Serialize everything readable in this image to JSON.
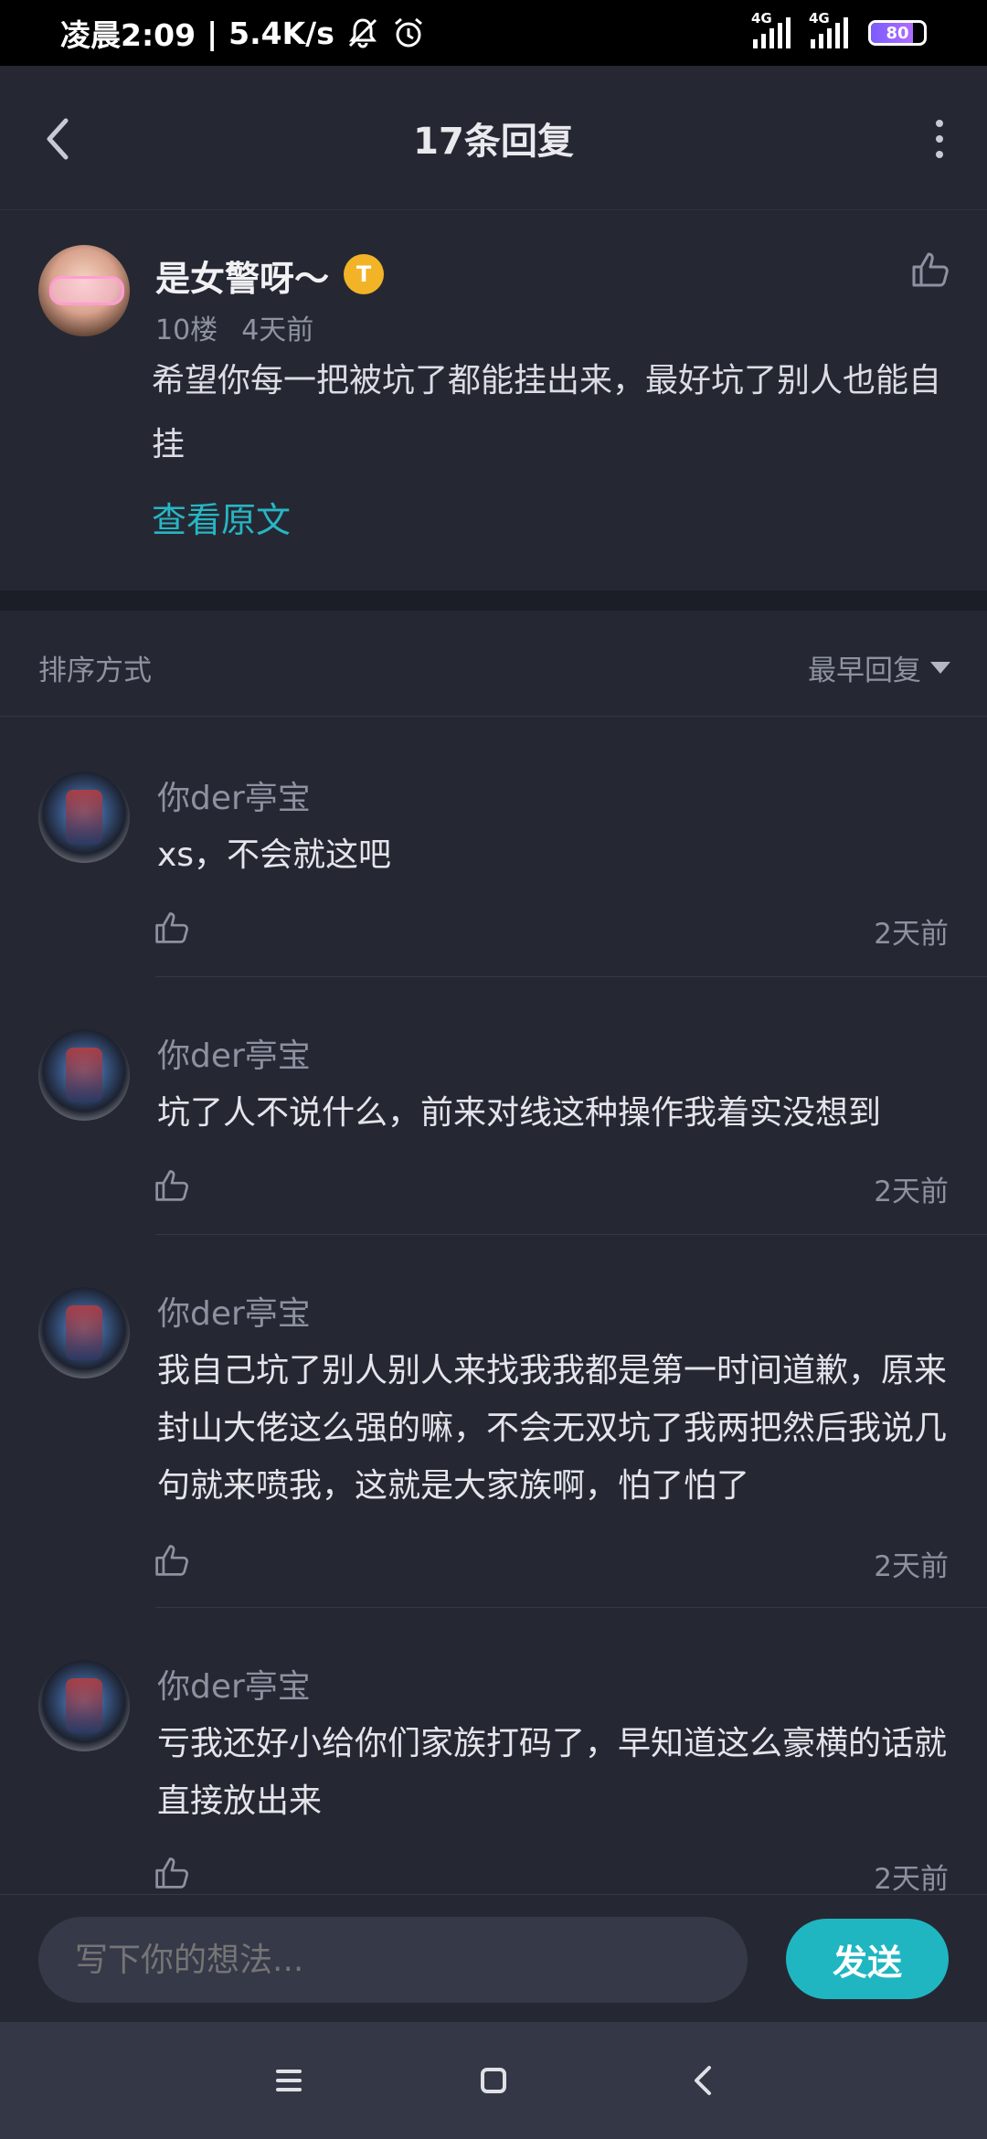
{
  "status_bar": {
    "time": "凌晨2:09",
    "separator": "|",
    "speed": "5.4K/s",
    "signal1_label": "4G",
    "signal2_label": "4G",
    "battery": "80"
  },
  "header": {
    "title": "17条回复"
  },
  "post": {
    "author": "是女警呀～",
    "badge": "T",
    "floor": "10楼",
    "time": "4天前",
    "content": "希望你每一把被坑了都能挂出来，最好坑了别人也能自挂",
    "view_original": "查看原文"
  },
  "sort": {
    "label": "排序方式",
    "selected": "最早回复"
  },
  "replies": [
    {
      "author": "你der亭宝",
      "text": "xs，不会就这吧",
      "time": "2天前"
    },
    {
      "author": "你der亭宝",
      "text": "坑了人不说什么，前来对线这种操作我着实没想到",
      "time": "2天前"
    },
    {
      "author": "你der亭宝",
      "text": "我自己坑了别人别人来找我我都是第一时间道歉，原来封山大佬这么强的嘛，不会无双坑了我两把然后我说几句就来喷我，这就是大家族啊，怕了怕了",
      "time": "2天前"
    },
    {
      "author": "你der亭宝",
      "text": "亏我还好小给你们家族打码了，早知道这么豪横的话就直接放出来",
      "time": "2天前"
    }
  ],
  "input": {
    "placeholder": "写下你的想法...",
    "send": "发送"
  },
  "colors": {
    "accent": "#1fb6c2",
    "background": "#252833",
    "link": "#27b6c4"
  }
}
